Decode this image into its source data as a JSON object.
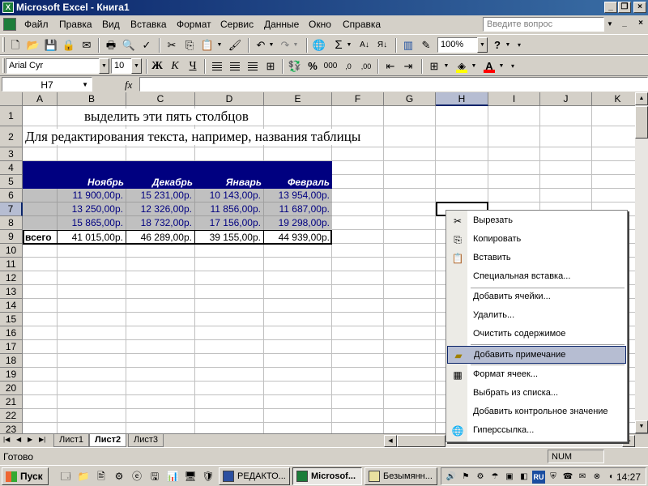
{
  "window": {
    "title": "Microsoft Excel - Книга1"
  },
  "menu": {
    "items": [
      "Файл",
      "Правка",
      "Вид",
      "Вставка",
      "Формат",
      "Сервис",
      "Данные",
      "Окно",
      "Справка"
    ],
    "help_placeholder": "Введите вопрос"
  },
  "toolbar": {
    "zoom": "100%",
    "font_name": "Arial Cyr",
    "font_size": "10",
    "bold_label": "Ж",
    "italic_label": "К",
    "underline_label": "Ч"
  },
  "formula_bar": {
    "name_box": "H7",
    "fx": "fx",
    "content": ""
  },
  "grid": {
    "columns": [
      "A",
      "B",
      "C",
      "D",
      "E",
      "F",
      "G",
      "H",
      "I",
      "J",
      "K"
    ],
    "rows": [
      "1",
      "2",
      "3",
      "4",
      "5",
      "6",
      "7",
      "8",
      "9",
      "10",
      "11",
      "12",
      "13",
      "14",
      "15",
      "16",
      "17",
      "18",
      "19",
      "20",
      "21",
      "22",
      "23"
    ],
    "title_row1": "выделить эти пять столбцов",
    "title_row2": "Для редактирования текста, например, названия таблицы",
    "months": [
      "Ноябрь",
      "Декабрь",
      "Январь",
      "Февраль"
    ],
    "data_rows": [
      [
        "11 900,00р.",
        "15 231,00р.",
        "10 143,00р.",
        "13 954,00р."
      ],
      [
        "13 250,00р.",
        "12 326,00р.",
        "11 856,00р.",
        "11 687,00р."
      ],
      [
        "15 865,00р.",
        "18 732,00р.",
        "17 156,00р.",
        "19 298,00р."
      ]
    ],
    "total_label": "всего",
    "totals": [
      "41 015,00р.",
      "46 289,00р.",
      "39 155,00р.",
      "44 939,00р."
    ]
  },
  "sheets": {
    "tabs": [
      "Лист1",
      "Лист2",
      "Лист3"
    ],
    "active": "Лист2"
  },
  "status": {
    "text": "Готово",
    "num": "NUM"
  },
  "context_menu": {
    "items": [
      {
        "label": "Вырезать",
        "icon": "scissors-icon"
      },
      {
        "label": "Копировать",
        "icon": "copy-icon"
      },
      {
        "label": "Вставить",
        "icon": "paste-icon"
      },
      {
        "label": "Специальная вставка...",
        "icon": ""
      },
      {
        "label": "Добавить ячейки...",
        "icon": ""
      },
      {
        "label": "Удалить...",
        "icon": ""
      },
      {
        "label": "Очистить содержимое",
        "icon": ""
      },
      {
        "label": "Добавить примечание",
        "icon": "comment-icon",
        "highlighted": true
      },
      {
        "label": "Формат ячеек...",
        "icon": "format-cells-icon"
      },
      {
        "label": "Выбрать из списка...",
        "icon": ""
      },
      {
        "label": "Добавить контрольное значение",
        "icon": ""
      },
      {
        "label": "Гиперссылка...",
        "icon": "hyperlink-icon"
      }
    ]
  },
  "taskbar": {
    "start": "Пуск",
    "tasks": [
      "РЕДАКТО...",
      "Microsof...",
      "Безымянн..."
    ],
    "active_task": "Microsof...",
    "tray_lang": "RU",
    "clock": "14:27"
  },
  "colors": {
    "title_start": "#0a246a",
    "title_end": "#3a6ea5",
    "table_header": "#000080",
    "table_body": "#c0c0c0",
    "highlight": "#b6bdd2"
  }
}
